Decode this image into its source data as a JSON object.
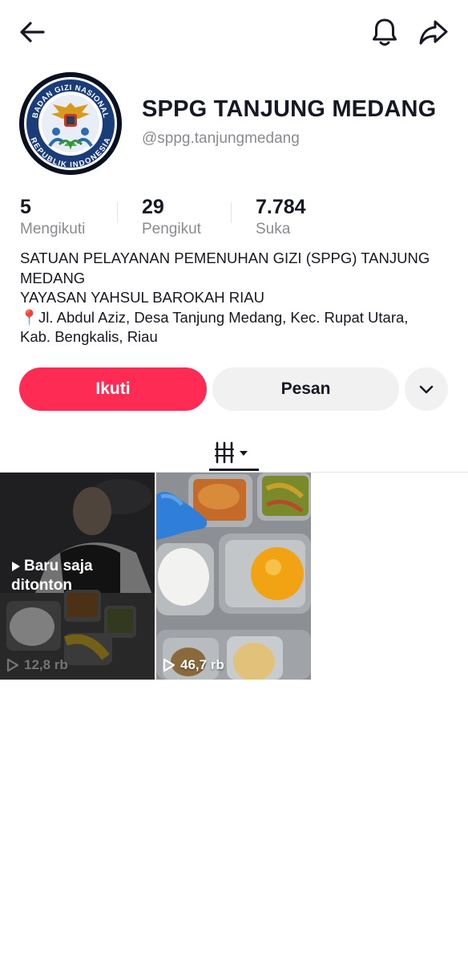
{
  "header": {
    "back_icon": "arrow-left-icon",
    "notification_icon": "bell-icon",
    "share_icon": "share-arrow-icon"
  },
  "profile": {
    "avatar_text_top": "BADAN GIZI NASIONAL",
    "avatar_text_bottom": "REPUBLIK INDONESIA",
    "name": "SPPG TANJUNG MEDANG",
    "handle": "@sppg.tanjungmedang"
  },
  "stats": [
    {
      "value": "5",
      "label": "Mengikuti"
    },
    {
      "value": "29",
      "label": "Pengikut"
    },
    {
      "value": "7.784",
      "label": "Suka"
    }
  ],
  "bio": {
    "line1": "SATUAN PELAYANAN PEMENUHAN GIZI (SPPG) TANJUNG",
    "line2": "MEDANG",
    "line3": "YAYASAN YAHSUL BAROKAH RIAU",
    "line4": "📍Jl. Abdul Aziz, Desa Tanjung Medang, Kec. Rupat Utara,",
    "line5": "Kab. Bengkalis, Riau"
  },
  "actions": {
    "follow_label": "Ikuti",
    "message_label": "Pesan",
    "more_icon": "chevron-down-icon"
  },
  "tabs": {
    "videos_icon": "grid-columns-icon"
  },
  "videos": [
    {
      "overlay_line1": "Baru saja",
      "overlay_line2": "ditonton",
      "views": "12,8 rb"
    },
    {
      "views": "46,7 rb"
    }
  ],
  "colors": {
    "primary": "#fe2c55",
    "text": "#161823",
    "muted": "#8a8b91",
    "button_bg": "#f1f1f2"
  }
}
